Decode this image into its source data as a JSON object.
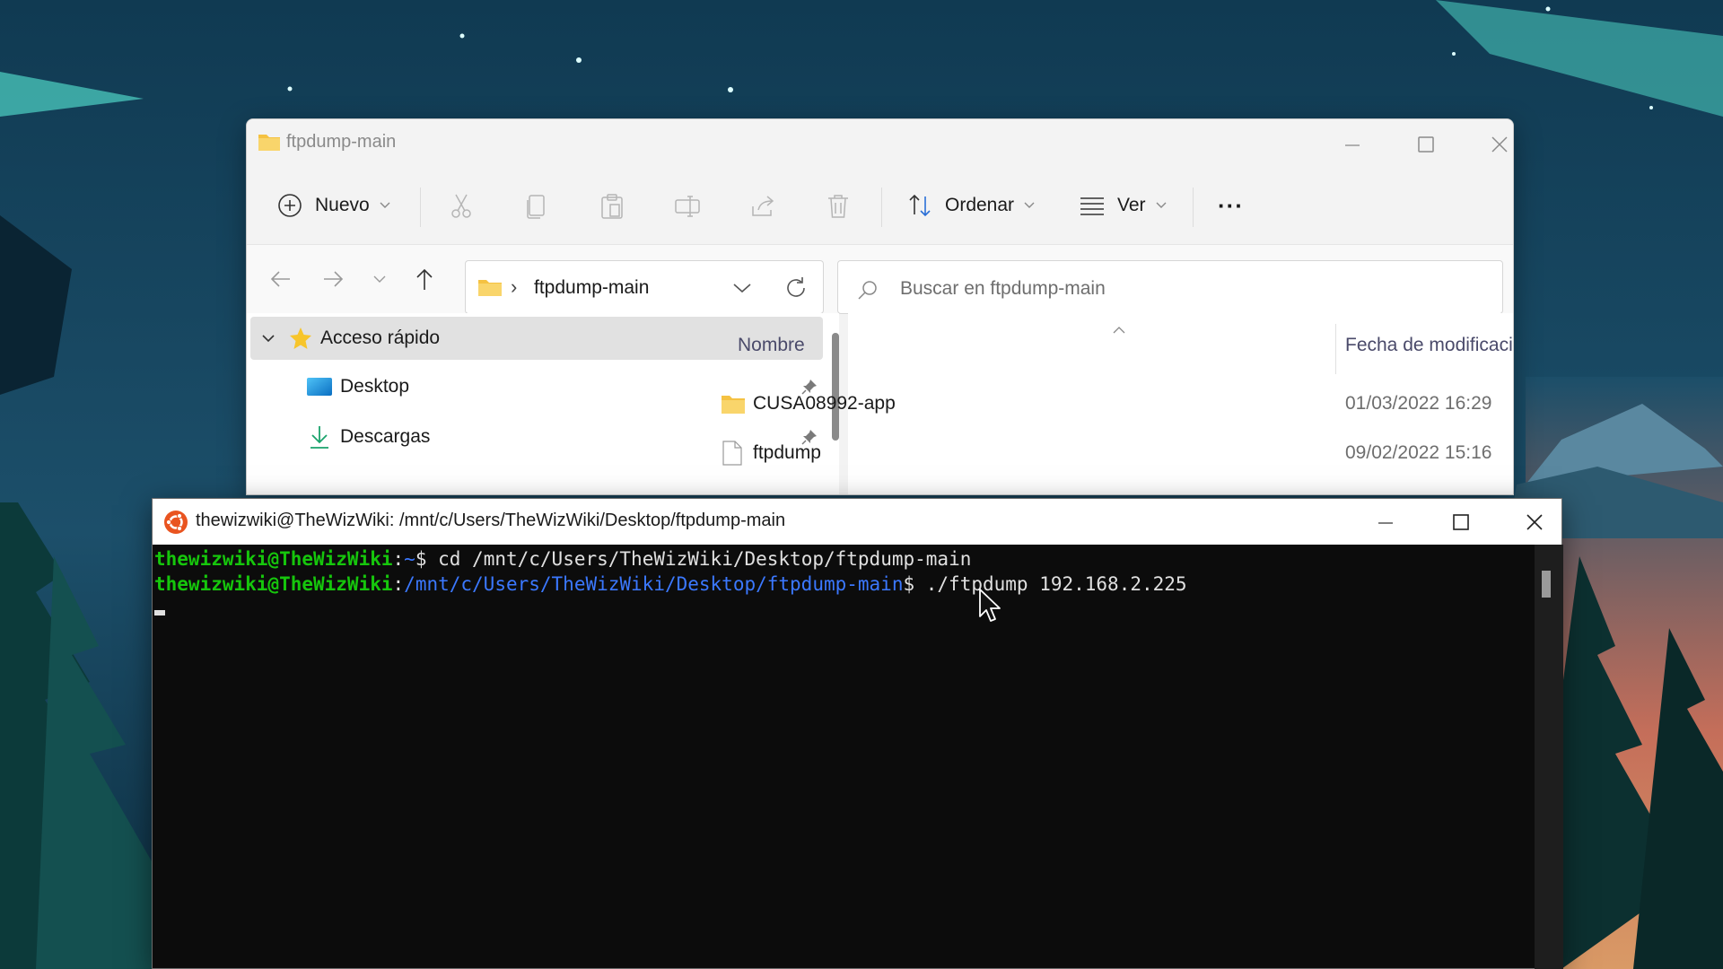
{
  "explorer": {
    "title": "ftpdump-main",
    "toolbar": {
      "new_label": "Nuevo",
      "sort_label": "Ordenar",
      "view_label": "Ver",
      "more_label": "···"
    },
    "address": {
      "separator": "›",
      "path": "ftpdump-main"
    },
    "search": {
      "placeholder": "Buscar en ftpdump-main"
    },
    "nav_pane": {
      "items": [
        {
          "label": "Acceso rápido",
          "icon": "star-icon",
          "selected": true
        },
        {
          "label": "Desktop",
          "icon": "desktop-icon",
          "pinned": true
        },
        {
          "label": "Descargas",
          "icon": "download-icon",
          "pinned": true
        }
      ]
    },
    "columns": {
      "name": "Nombre",
      "date": "Fecha de modificació"
    },
    "files": [
      {
        "name": "CUSA08992-app",
        "type": "folder",
        "date": "01/03/2022 16:29"
      },
      {
        "name": "ftpdump",
        "type": "file",
        "date": "09/02/2022 15:16"
      }
    ]
  },
  "terminal": {
    "title": "thewizwiki@TheWizWiki: /mnt/c/Users/TheWizWiki/Desktop/ftpdump-main",
    "lines": [
      {
        "user": "thewizwiki@TheWizWiki",
        "sep": ":",
        "path": "~",
        "prompt": "$ ",
        "cmd": "cd /mnt/c/Users/TheWizWiki/Desktop/ftpdump-main"
      },
      {
        "user": "thewizwiki@TheWizWiki",
        "sep": ":",
        "path": "/mnt/c/Users/TheWizWiki/Desktop/ftpdump-main",
        "prompt": "$ ",
        "cmd": "./ftpdump 192.168.2.225"
      }
    ]
  },
  "colors": {
    "terminal_user": "#16c60c",
    "terminal_path": "#3b78ff",
    "terminal_bg": "#0c0c0c",
    "explorer_bg": "#f3f3f3",
    "folder_yellow": "#f5c242"
  }
}
